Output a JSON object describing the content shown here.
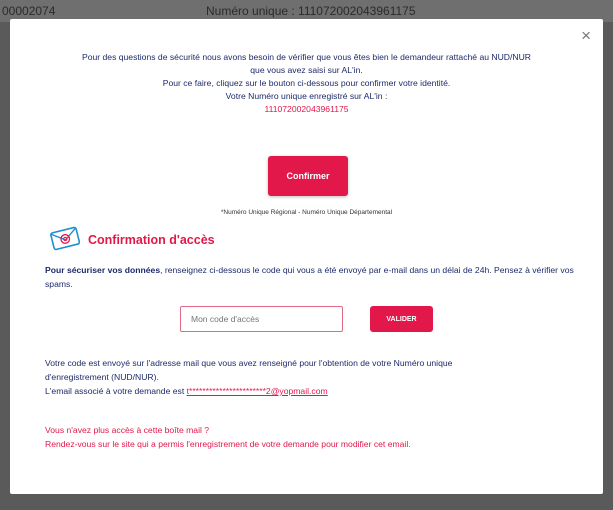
{
  "backdrop": {
    "left_text": "00002074",
    "right_text": "Numéro unique : 111072002043961175"
  },
  "modal": {
    "close_glyph": "×",
    "intro": {
      "line1": "Pour des questions de sécurité nous avons besoin de vérifier que vous êtes bien le demandeur rattaché au NUD/NUR",
      "line2": "que vous avez saisi sur AL'in.",
      "line3": "Pour ce faire, cliquez sur le bouton ci-dessous pour confirmer votre identité.",
      "line4": "Votre Numéro unique enregistré sur AL'in :",
      "number": "111072002043961175"
    },
    "confirm_label": "Confirmer",
    "footnote": "*Numéro Unique Régional - Numéro Unique Départemental",
    "section_title": "Confirmation d'accès",
    "instructions": {
      "bold": "Pour sécuriser vos données",
      "rest": ", renseignez ci-dessous le code qui vous a été envoyé par e-mail dans un délai de 24h. Pensez à vérifier vos spams."
    },
    "code_input": {
      "placeholder": "Mon code d'accès",
      "value": ""
    },
    "valider_label": "VALIDER",
    "email_info": {
      "line1": "Votre code est envoyé sur l'adresse mail que vous avez renseigné pour l'obtention de votre Numéro unique",
      "line2": "d'enregistrement (NUD/NUR).",
      "line3_prefix": "L'email associé à votre demande est ",
      "email": "t***********************2@yopmail.com"
    },
    "no_access": {
      "line1": "Vous n'avez plus accès à cette boîte mail ?",
      "line2": "Rendez-vous sur le site qui a permis l'enregistrement de votre demande pour modifier cet email."
    }
  },
  "colors": {
    "accent": "#e2174a",
    "text": "#1e2a6a"
  },
  "icons": {
    "section": "email-envelope-icon",
    "close": "close-icon"
  }
}
